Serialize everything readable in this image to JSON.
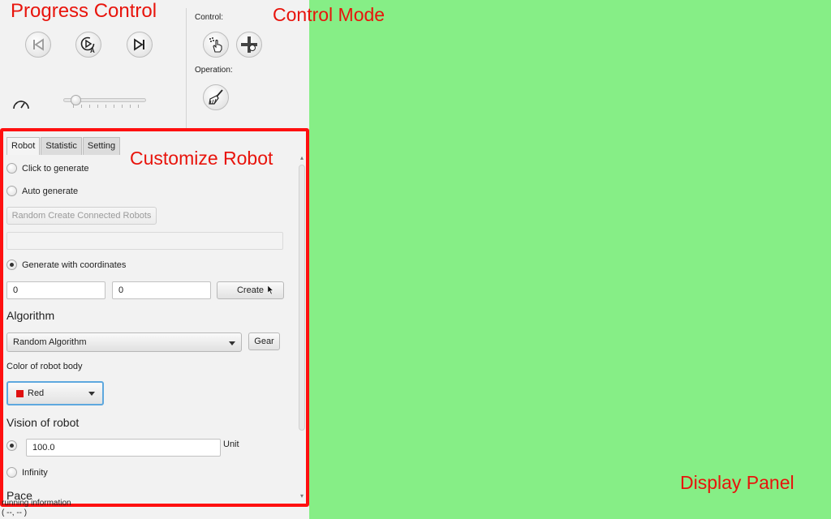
{
  "annotations": {
    "progress_control": "Progress Control",
    "control_mode": "Control Mode",
    "customize_robot": "Customize Robot",
    "display_panel": "Display Panel"
  },
  "progress": {
    "buttons": [
      {
        "name": "previous-step-button",
        "icon": "skip-previous-icon"
      },
      {
        "name": "auto-play-button",
        "icon": "auto-play-icon"
      },
      {
        "name": "next-step-button",
        "icon": "skip-next-icon"
      }
    ],
    "speed_icon": "speedometer-icon"
  },
  "control": {
    "label": "Control:",
    "operation_label": "Operation:",
    "icons": [
      "hand-pointer-icon",
      "move-cross-icon",
      "broom-icon"
    ]
  },
  "tabs": [
    {
      "label": "Robot",
      "active": true
    },
    {
      "label": "Statistic",
      "active": false
    },
    {
      "label": "Setting",
      "active": false
    }
  ],
  "robot": {
    "click_to_generate": "Click to generate",
    "auto_generate": "Auto generate",
    "random_create_button": "Random Create Connected Robots",
    "random_count_value": "",
    "generate_with_coordinates": "Generate with coordinates",
    "x_value": "0",
    "y_value": "0",
    "create_button": "Create",
    "algorithm_heading": "Algorithm",
    "algorithm_selected": "Random Algorithm",
    "gear_button": "Gear",
    "color_label": "Color of robot body",
    "color_selected": "Red",
    "color_swatch": "#e01010",
    "vision_heading": "Vision of robot",
    "vision_value": "100.0",
    "vision_unit": "Unit",
    "infinity_label": "Infinity",
    "pace_heading": "Pace"
  },
  "bottom": {
    "running_info": "running information",
    "coordinates": "( --, -- )"
  },
  "colors": {
    "display_panel": "#86ee86",
    "annotation": "#e8140c",
    "highlight_border": "#ff1010"
  }
}
